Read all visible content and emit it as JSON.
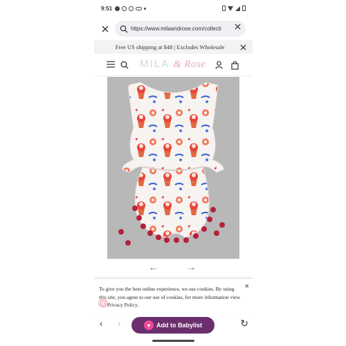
{
  "status_bar": {
    "time": "9:51",
    "icons": [
      "messenger-icon",
      "mail-icon",
      "pinterest-icon",
      "voicemail-icon",
      "dot-icon"
    ],
    "right_icons": [
      "vibrate-icon",
      "wifi-icon",
      "signal-icon",
      "battery-icon"
    ]
  },
  "browser": {
    "url": "https://www.milaandrose.com/collecti",
    "close_icon": "close-icon",
    "search_icon": "search-icon",
    "clear_icon": "close-icon"
  },
  "promo": {
    "text": "Free US shipping at $48 | Excludes Wholesale",
    "close_icon": "close-icon"
  },
  "site_header": {
    "logo_left": "MILA ",
    "logo_amp": "&",
    "logo_right": " Rose",
    "icons": [
      "menu-icon",
      "search-icon",
      "account-icon",
      "bag-icon"
    ]
  },
  "gallery": {
    "prev_icon": "←",
    "next_icon": "→"
  },
  "cookie": {
    "text": "To give you the best online experience, we use cookies. By using this site, you agree to our use of cookies, for more information view our Privacy Policy.",
    "close_icon": "×",
    "badge_icon": "x"
  },
  "bottom_bar": {
    "back": "‹",
    "forward": "›",
    "babylist_label": "Add to Babylist",
    "refresh": "↻"
  },
  "colors": {
    "babylist": "#6b2f6e",
    "heart": "#ee4b97",
    "pompom": "#b3203a"
  }
}
